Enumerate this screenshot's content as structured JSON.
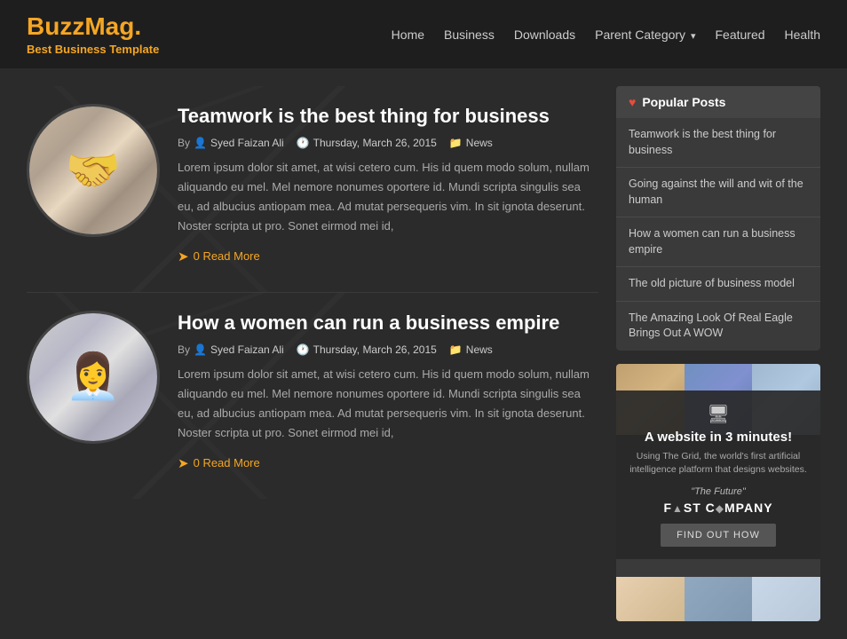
{
  "header": {
    "logo_title": "BuzzMag",
    "logo_dot": ".",
    "logo_subtitle": "Best Business Template",
    "nav": [
      {
        "label": "Home",
        "url": "#"
      },
      {
        "label": "Business",
        "url": "#"
      },
      {
        "label": "Downloads",
        "url": "#"
      },
      {
        "label": "Parent Category",
        "url": "#",
        "has_dropdown": true
      },
      {
        "label": "Featured",
        "url": "#"
      },
      {
        "label": "Health",
        "url": "#"
      }
    ]
  },
  "articles": [
    {
      "title": "Teamwork is the best thing for business",
      "author": "Syed Faizan Ali",
      "date": "Thursday, March 26, 2015",
      "category": "News",
      "excerpt": "Lorem ipsum dolor sit amet, at wisi cetero cum. His id quem modo solum, nullam aliquando eu mel. Mel nemore nonumes oportere id. Mundi scripta singulis sea eu, ad albucius antiopam mea. Ad mutat persequeris vim. In sit ignota deserunt. Noster scripta ut pro. Sonet eirmod mei id,",
      "read_more": "Read More",
      "type": "business"
    },
    {
      "title": "How a women can run a business empire",
      "author": "Syed Faizan Ali",
      "date": "Thursday, March 26, 2015",
      "category": "News",
      "excerpt": "Lorem ipsum dolor sit amet, at wisi cetero cum. His id quem modo solum, nullam aliquando eu mel. Mel nemore nonumes oportere id. Mundi scripta singulis sea eu, ad albucius antiopam mea. Ad mutat persequeris vim. In sit ignota deserunt. Noster scripta ut pro. Sonet eirmod mei id,",
      "read_more": "Read More",
      "type": "women"
    }
  ],
  "sidebar": {
    "popular_posts_header": "Popular Posts",
    "popular_posts": [
      "Teamwork is the best thing for business",
      "Going against the will and wit of the human",
      "How a women can run a business empire",
      "The old picture of business model",
      "The Amazing Look Of Real Eagle Brings Out A WOW"
    ],
    "ad": {
      "icon": "🖥",
      "title": "A website in 3 minutes!",
      "sub": "Using The Grid, the world's first artificial intelligence platform that designs websites.",
      "quote": "\"The Future\"",
      "brand": "F▲ST C◆MPANY",
      "cta": "FIND OUT HOW"
    }
  },
  "labels": {
    "by": "By",
    "comments_count": "0"
  }
}
